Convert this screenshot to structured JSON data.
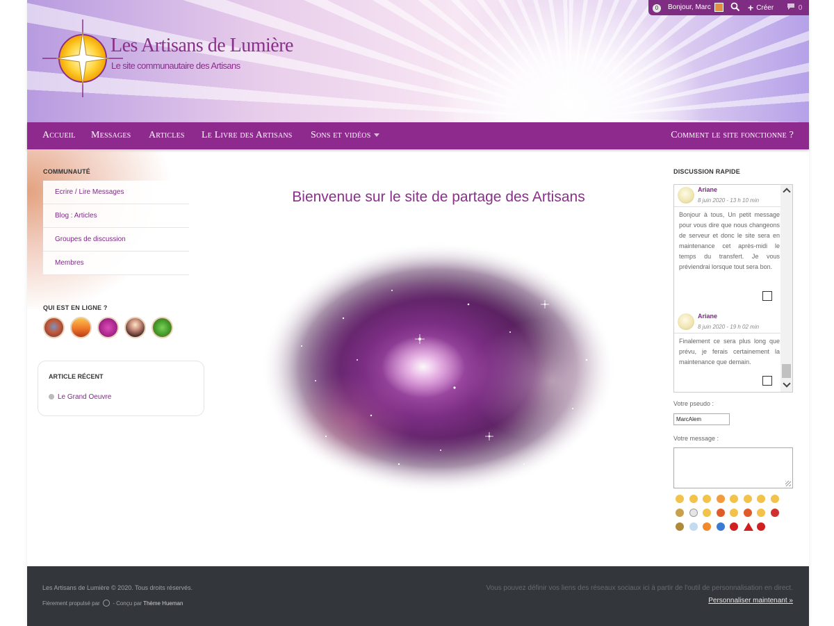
{
  "colors": {
    "brand_purple": "#8e2a8d",
    "link_purple": "#7c2a85",
    "footer_bg": "#33363b"
  },
  "adminbar": {
    "notification_count": "0",
    "greeting": "Bonjour, Marc",
    "create_label": "Créer",
    "comments_count": "0",
    "icons": [
      "search-icon",
      "plus-icon",
      "comment-icon"
    ]
  },
  "site": {
    "title": "Les Artisans de Lumière",
    "tagline": "Le site communautaire des Artisans"
  },
  "nav": {
    "items": [
      "Accueil",
      "Messages",
      "Articles",
      "Le Livre des Artisans",
      "Sons et vidéos"
    ],
    "right_item": "Comment le site fonctionne ?"
  },
  "left_sidebar": {
    "community_heading": "COMMUNAUTÉ",
    "menu": [
      "Ecrire / Lire Messages",
      "Blog : Articles",
      "Groupes de discussion",
      "Membres"
    ],
    "online_heading": "QUI EST EN LIGNE ?",
    "online_count": 5,
    "recent_heading": "ARTICLE RÉCENT",
    "recent_article": "Le Grand Oeuvre"
  },
  "main": {
    "welcome": "Bienvenue sur le site de partage des Artisans"
  },
  "right_sidebar": {
    "heading": "DISCUSSION RAPIDE",
    "messages": [
      {
        "author": "Ariane",
        "date": "8 juin 2020 - 13 h 10 min",
        "text": "Bonjour à tous, Un petit message pour vous dire que nous changeons de serveur et donc le site sera en maintenance cet après-midi le temps du transfert. Je vous préviendrai lorsque tout sera bon."
      },
      {
        "author": "Ariane",
        "date": "8 juin 2020 - 19 h 02 min",
        "text": "Finalement ce sera plus long que prévu, je ferais certainement la maintenance que demain."
      }
    ],
    "pseudo_label": "Votre pseudo :",
    "pseudo_value": "MarcAlem",
    "message_label": "Votre message :",
    "message_value": ""
  },
  "footer": {
    "copyright": "Les Artisans de Lumière © 2020. Tous droits réservés.",
    "powered_prefix": "Fièrement propulsé par",
    "powered_mid": " - Conçu par ",
    "theme_name": "Thème Hueman",
    "social_text": "Vous pouvez définir vos liens des réseaux sociaux ici à partir de l'outil de personnalisation en direct.",
    "customize_link": "Personnaliser maintenant »"
  }
}
